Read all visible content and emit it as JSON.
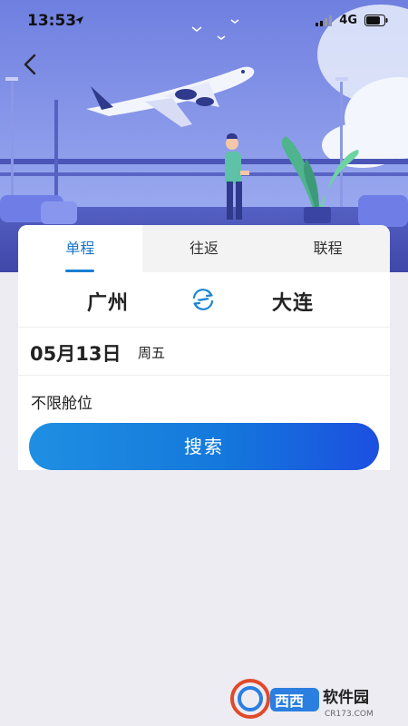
{
  "status_bar": {
    "time": "13:53",
    "carrier": "4G"
  },
  "nav": {
    "back_icon": "chevron-left-icon"
  },
  "tabs": [
    {
      "label": "单程",
      "active": true
    },
    {
      "label": "往返",
      "active": false
    },
    {
      "label": "联程",
      "active": false
    }
  ],
  "route": {
    "from": "广州",
    "to": "大连",
    "swap_icon": "swap-icon"
  },
  "date": {
    "value": "05月13日",
    "weekday": "周五"
  },
  "cabin": {
    "value": "不限舱位"
  },
  "search": {
    "label": "搜索"
  },
  "watermark": {
    "text": "西西软件园",
    "url": "CR173.COM"
  },
  "colors": {
    "accent": "#1877c8",
    "button_start": "#1f8fe2",
    "button_end": "#1c4fe0",
    "background": "#eeecf3"
  }
}
